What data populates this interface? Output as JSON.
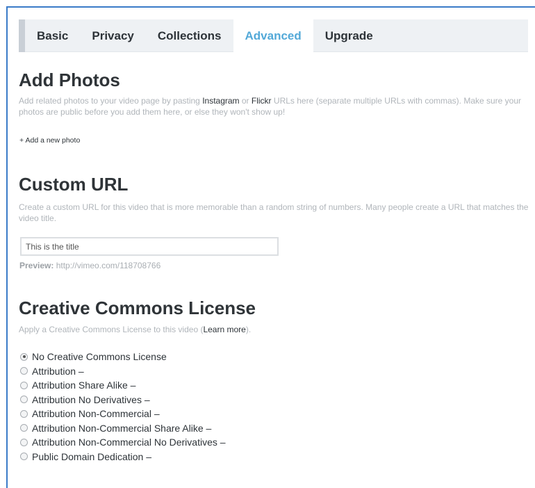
{
  "tabs": [
    {
      "label": "Basic",
      "active": false
    },
    {
      "label": "Privacy",
      "active": false
    },
    {
      "label": "Collections",
      "active": false
    },
    {
      "label": "Advanced",
      "active": true
    },
    {
      "label": "Upgrade",
      "active": false
    }
  ],
  "add_photos": {
    "title": "Add Photos",
    "desc_1": "Add related photos to your video page by pasting ",
    "link_instagram": "Instagram",
    "desc_or": " or ",
    "link_flickr": "Flickr",
    "desc_2": " URLs here (separate multiple URLs with commas). Make sure your photos are public before you add them here, or else they won't show up!",
    "add_link": "+ Add a new photo"
  },
  "custom_url": {
    "title": "Custom URL",
    "desc": "Create a custom URL for this video that is more memorable than a random string of numbers. Many people create a URL that matches the video title.",
    "input_value": "This is the title",
    "preview_label": "Preview:",
    "preview_url": "http://vimeo.com/118708766"
  },
  "cc": {
    "title": "Creative Commons License",
    "desc_1": "Apply a Creative Commons License to this video (",
    "learn_more": "Learn more",
    "desc_2": ").",
    "options": [
      {
        "label": "No Creative Commons License",
        "checked": true
      },
      {
        "label": "Attribution –",
        "checked": false
      },
      {
        "label": "Attribution Share Alike –",
        "checked": false
      },
      {
        "label": "Attribution No Derivatives –",
        "checked": false
      },
      {
        "label": "Attribution Non-Commercial –",
        "checked": false
      },
      {
        "label": "Attribution Non-Commercial Share Alike –",
        "checked": false
      },
      {
        "label": "Attribution Non-Commercial No Derivatives –",
        "checked": false
      },
      {
        "label": "Public Domain Dedication –",
        "checked": false
      }
    ]
  },
  "colors": {
    "accent": "#53a9d8",
    "tab_bar": "#eef1f4",
    "frame_border": "#3a7bc8",
    "muted_text": "#b0b5ba"
  }
}
